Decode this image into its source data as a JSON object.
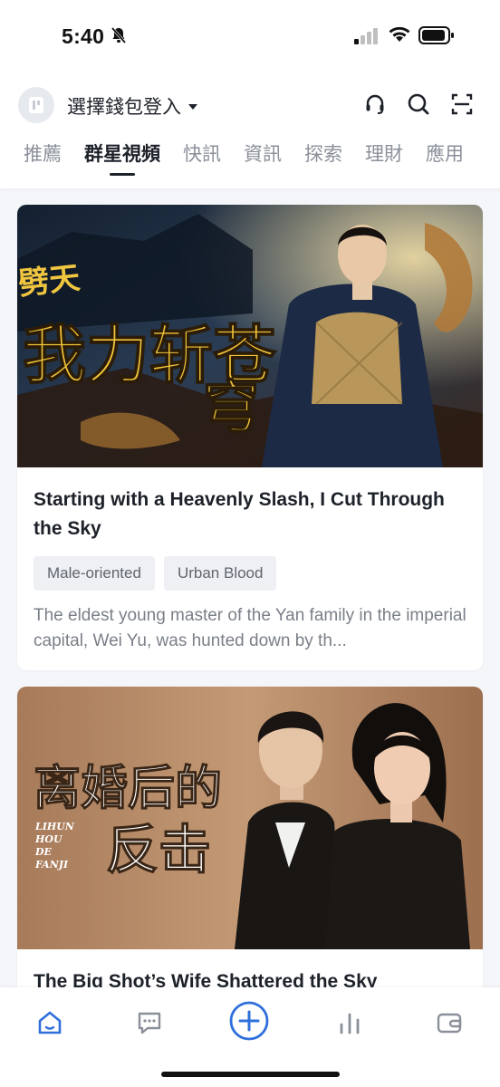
{
  "status": {
    "time": "5:40",
    "icons": [
      "bell-slash-icon",
      "cellular-signal-icon",
      "wifi-icon",
      "battery-icon"
    ]
  },
  "header": {
    "wallet_login": "選擇錢包登入",
    "icons": [
      "headset-icon",
      "search-icon",
      "scan-icon"
    ]
  },
  "tabs": [
    {
      "label": "推薦",
      "active": false
    },
    {
      "label": "群星視頻",
      "active": true
    },
    {
      "label": "快訊",
      "active": false
    },
    {
      "label": "資訊",
      "active": false
    },
    {
      "label": "探索",
      "active": false
    },
    {
      "label": "理財",
      "active": false
    },
    {
      "label": "應用",
      "active": false
    }
  ],
  "feed": [
    {
      "poster_text_top": "一刀劈天",
      "poster_text_main": [
        "我力斩苍",
        "穹"
      ],
      "title": "Starting with a Heavenly Slash, I Cut Through the Sky",
      "tags": [
        "Male-oriented",
        "Urban Blood"
      ],
      "description": "The eldest young master of the Yan family in the imperial capital, Wei Yu, was hunted down by th..."
    },
    {
      "poster_text_main": [
        "离婚后的",
        "反击"
      ],
      "poster_text_pinyin": [
        "LIHUN",
        "HOU",
        "DE",
        "FANJI"
      ],
      "title": "The Big Shot’s Wife Shattered the Sky"
    }
  ],
  "bottom_nav": [
    "home-icon",
    "chat-icon",
    "add-icon",
    "markets-icon",
    "wallet-icon"
  ],
  "colors": {
    "accent": "#2f6fdb",
    "text": "#1d2129",
    "muted": "#8a8f99"
  }
}
